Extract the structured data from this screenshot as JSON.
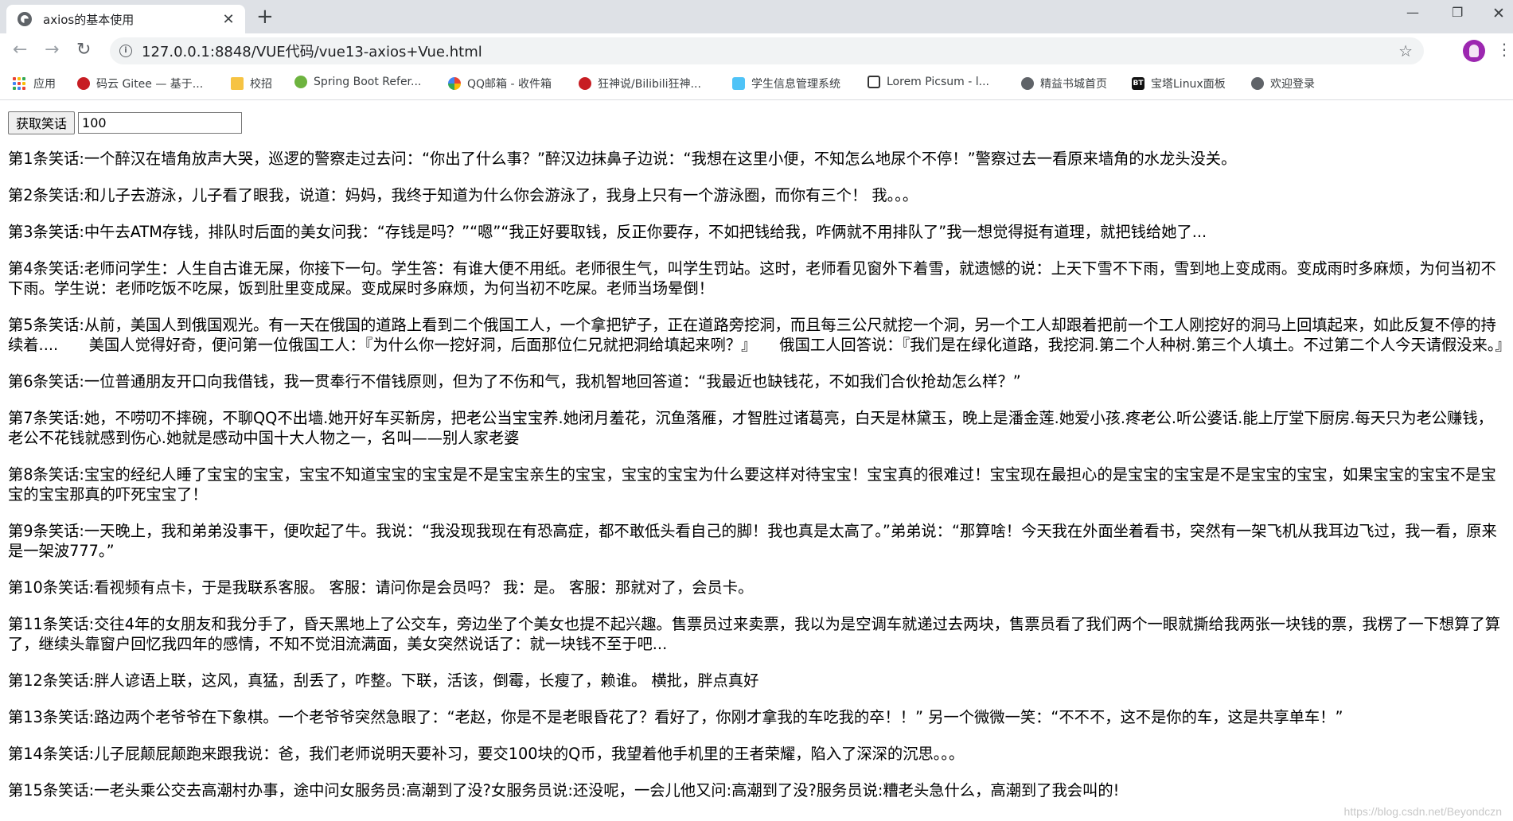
{
  "browser": {
    "tab_title": "axios的基本使用",
    "tab_close": "✕",
    "new_tab": "+",
    "url": "127.0.0.1:8848/VUE代码/vue13-axios+Vue.html",
    "bookmarks": [
      {
        "label": "应用",
        "icon": "apps-icon",
        "color": "#4285f4"
      },
      {
        "label": "码云 Gitee — 基于...",
        "icon": "gitee-icon",
        "color": "#c71d23"
      },
      {
        "label": "校招",
        "icon": "folder-icon",
        "color": "#f6c343"
      },
      {
        "label": "Spring Boot Refer...",
        "icon": "spring-icon",
        "color": "#6db33f"
      },
      {
        "label": "QQ邮箱 - 收件箱",
        "icon": "qq-mail-icon",
        "color": "#f4b400"
      },
      {
        "label": "狂神说/Bilibili狂神...",
        "icon": "gitee-icon",
        "color": "#c71d23"
      },
      {
        "label": "学生信息管理系统",
        "icon": "shield-icon",
        "color": "#4fc3f7"
      },
      {
        "label": "Lorem Picsum - l...",
        "icon": "picsum-icon",
        "color": "#333333"
      },
      {
        "label": "精益书城首页",
        "icon": "globe-icon",
        "color": "#5f6368"
      },
      {
        "label": "宝塔Linux面板",
        "icon": "bt-icon",
        "color": "#111111"
      },
      {
        "label": "欢迎登录",
        "icon": "globe-icon",
        "color": "#5f6368"
      }
    ]
  },
  "page": {
    "button_label": "获取笑话",
    "count_value": "100",
    "jokes": [
      "第1条笑话:一个醉汉在墙角放声大哭，巡逻的警察走过去问：“你出了什么事？”醉汉边抹鼻子边说：“我想在这里小便，不知怎么地尿个不停！”警察过去一看原来墙角的水龙头没关。",
      "第2条笑话:和儿子去游泳，儿子看了眼我，说道：妈妈，我终于知道为什么你会游泳了，我身上只有一个游泳圈，而你有三个！ 我。。。",
      "第3条笑话:中午去ATM存钱，排队时后面的美女问我：“存钱是吗？”“嗯”“我正好要取钱，反正你要存，不如把钱给我，咋俩就不用排队了”我一想觉得挺有道理，就把钱给她了...",
      "第4条笑话:老师问学生：人生自古谁无屎，你接下一句。学生答：有谁大便不用纸。老师很生气，叫学生罚站。这时，老师看见窗外下着雪，就遗憾的说：上天下雪不下雨，雪到地上变成雨。变成雨时多麻烦，为何当初不下雨。学生说：老师吃饭不吃屎，饭到肚里变成屎。变成屎时多麻烦，为何当初不吃屎。老师当场晕倒！",
      "第5条笑话:从前，美国人到俄国观光。有一天在俄国的道路上看到二个俄国工人，一个拿把铲子，正在道路旁挖洞，而且每三公尺就挖一个洞，另一个工人却跟着把前一个工人刚挖好的洞马上回填起来，如此反复不停的持续着....　　美国人觉得好奇，便问第一位俄国工人：『为什么你一挖好洞，后面那位仁兄就把洞给填起来咧？』　　俄国工人回答说：『我们是在绿化道路，我挖洞.第二个人种树.第三个人填土。不过第二个人今天请假没来。』",
      "第6条笑话:一位普通朋友开口向我借钱，我一贯奉行不借钱原则，但为了不伤和气，我机智地回答道：“我最近也缺钱花，不如我们合伙抢劫怎么样？”",
      "第7条笑话:她，不唠叨不摔碗，不聊QQ不出墙.她开好车买新房，把老公当宝宝养.她闭月羞花，沉鱼落雁，才智胜过诸葛亮，白天是林黛玉，晚上是潘金莲.她爱小孩.疼老公.听公婆话.能上厅堂下厨房.每天只为老公赚钱，老公不花钱就感到伤心.她就是感动中国十大人物之一，名叫——别人家老婆",
      "第8条笑话:宝宝的经纪人睡了宝宝的宝宝，宝宝不知道宝宝的宝宝是不是宝宝亲生的宝宝，宝宝的宝宝为什么要这样对待宝宝！宝宝真的很难过！宝宝现在最担心的是宝宝的宝宝是不是宝宝的宝宝，如果宝宝的宝宝不是宝宝的宝宝那真的吓死宝宝了！",
      "第9条笑话:一天晚上，我和弟弟没事干，便吹起了牛。我说：“我没现我现在有恐高症，都不敢低头看自己的脚！我也真是太高了。”弟弟说：“那算啥！今天我在外面坐着看书，突然有一架飞机从我耳边飞过，我一看，原来是一架波777。”",
      "第10条笑话:看视频有点卡，于是我联系客服。 客服：请问你是会员吗？ 我：是。 客服：那就对了，会员卡。",
      "第11条笑话:交往4年的女朋友和我分手了，昏天黑地上了公交车，旁边坐了个美女也提不起兴趣。售票员过来卖票，我以为是空调车就递过去两块，售票员看了我们两个一眼就撕给我两张一块钱的票，我楞了一下想算了算了，继续头靠窗户回忆我四年的感情，不知不觉泪流满面，美女突然说话了：就一块钱不至于吧...",
      "第12条笑话:胖人谚语上联，这风，真猛，刮丢了，咋整。下联，活该，倒霉，长瘦了，赖谁。 横批，胖点真好",
      "第13条笑话:路边两个老爷爷在下象棋。一个老爷爷突然急眼了：“老赵，你是不是老眼昏花了？看好了，你刚才拿我的车吃我的卒！！” 另一个微微一笑：“不不不，这不是你的车，这是共享单车！”",
      "第14条笑话:儿子屁颠屁颠跑来跟我说：爸，我们老师说明天要补习，要交100块的Q币，我望着他手机里的王者荣耀，陷入了深深的沉思。。。",
      "第15条笑话:一老头乘公交去高潮村办事，途中问女服务员:高潮到了没?女服务员说:还没呢，一会儿他又问:高潮到了没?服务员说:糟老头急什么，高潮到了我会叫的!"
    ]
  },
  "watermark": "https://blog.csdn.net/Beyondczn"
}
